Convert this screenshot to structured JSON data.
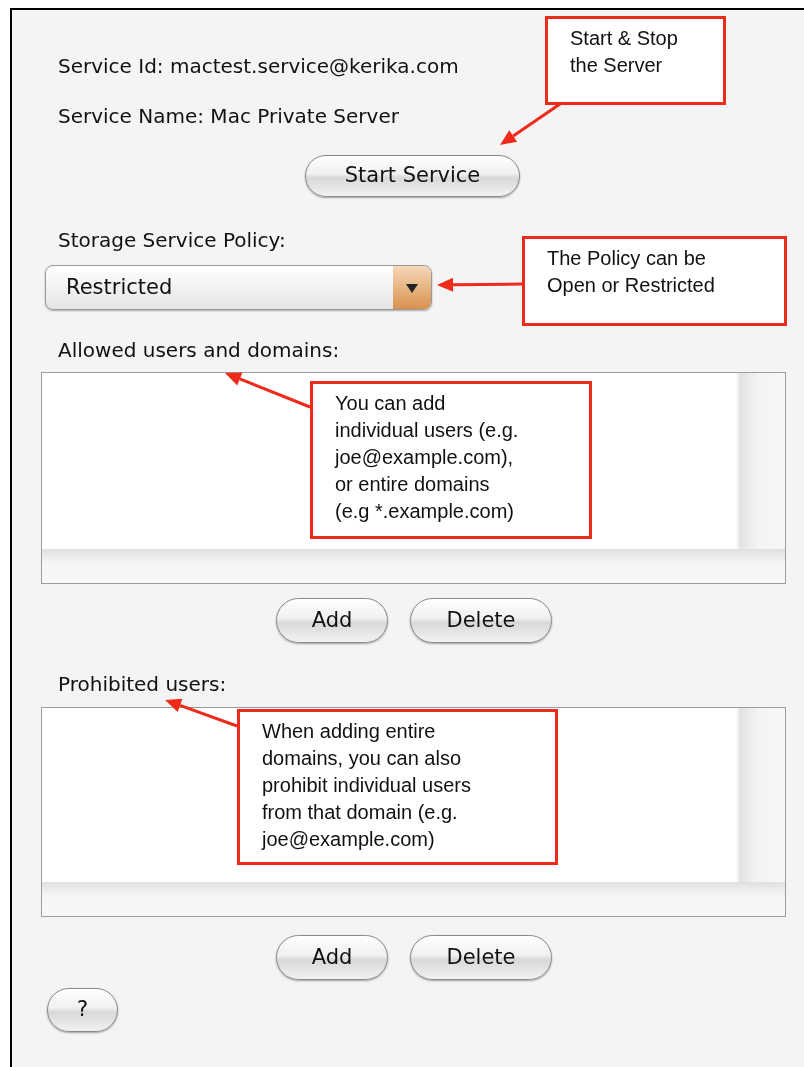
{
  "service_id": "Service Id: mactest.service@kerika.com",
  "service_name": "Service Name: Mac Private Server",
  "start_button": "Start Service",
  "policy": {
    "label": "Storage Service Policy:",
    "value": "Restricted"
  },
  "allowed": {
    "label": "Allowed users and domains:",
    "buttons": [
      "Add",
      "Delete"
    ]
  },
  "prohibited": {
    "label": "Prohibited users:",
    "buttons": [
      "Add",
      "Delete"
    ]
  },
  "help_button": "?",
  "callouts": [
    {
      "text": "Start & Stop\nthe Server"
    },
    {
      "text": "The Policy can be\nOpen or Restricted"
    },
    {
      "text": "You can add\nindividual users (e.g.\njoe@example.com),\nor entire domains\n(e.g *.example.com)"
    },
    {
      "text": "When adding entire\ndomains, you can also\nprohibit individual users\nfrom that domain (e.g.\njoe@example.com)"
    }
  ]
}
